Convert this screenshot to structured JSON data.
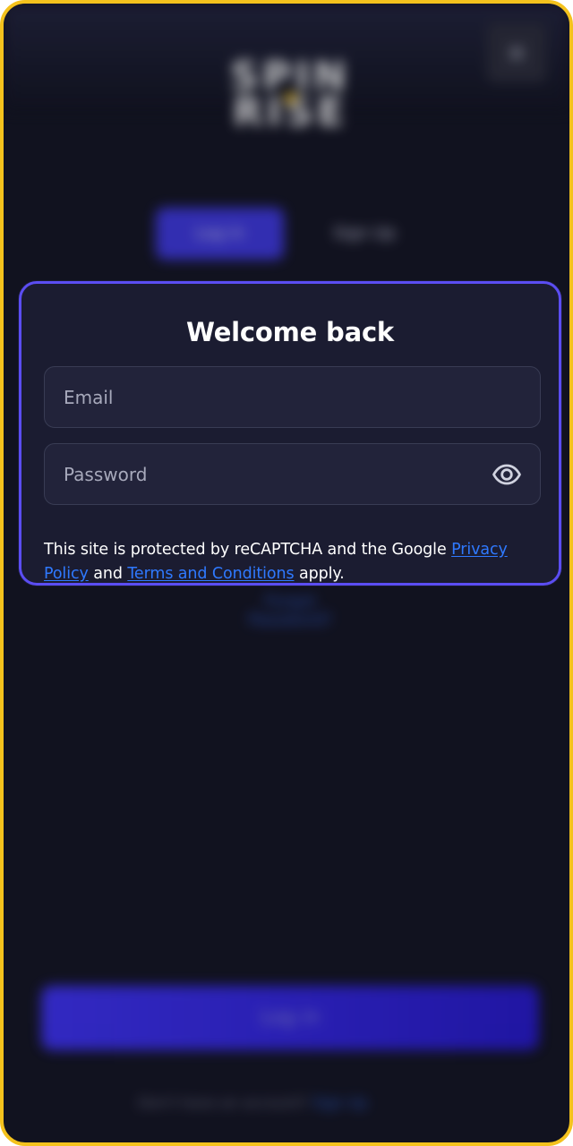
{
  "background": {
    "logo_top": "SPIN",
    "logo_bottom": "RISE",
    "close_symbol": "×",
    "tabs": [
      {
        "label": "Log in"
      },
      {
        "label": "Sign Up"
      }
    ],
    "forgot_link": "Forgot Password?",
    "login_button": "Log in",
    "footer_text": "Don't have an account?",
    "footer_link": "Sign Up"
  },
  "login_card": {
    "title": "Welcome back",
    "email": {
      "value": "",
      "placeholder": "Email"
    },
    "password": {
      "value": "",
      "placeholder": "Password",
      "visibility_icon": "eye-icon"
    },
    "legal": {
      "prefix": "This site is protected by reCAPTCHA and the Google ",
      "privacy_link": "Privacy Policy",
      "middle": " and ",
      "terms_link": "Terms and Conditions",
      "suffix": " apply."
    }
  },
  "colors": {
    "frame": "#f4c21d",
    "background": "#11121f",
    "card": "#1b1c31",
    "card_border": "#5b4df2",
    "link": "#2f79ff",
    "primary_button": "#3c30f0"
  }
}
